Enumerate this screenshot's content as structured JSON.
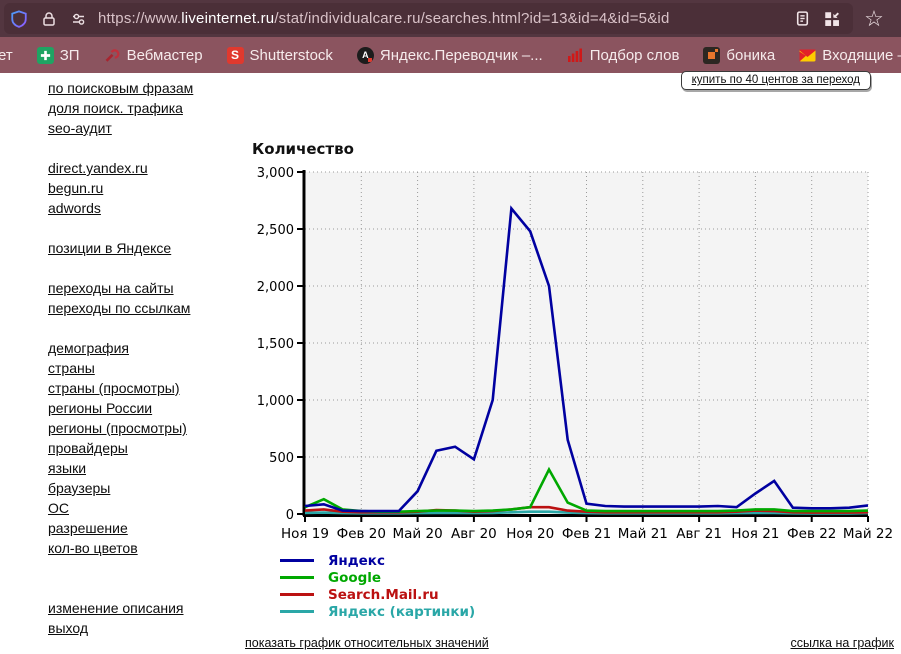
{
  "browser": {
    "url_prefix": "https://www.",
    "url_domain": "liveinternet.ru",
    "url_path": "/stat/individualcare.ru/searches.html?id=13&id=4&id=5&id"
  },
  "bookmarks": {
    "items": [
      {
        "label": "ет",
        "icon": "none"
      },
      {
        "label": "ЗП",
        "icon": "green-plus"
      },
      {
        "label": "Вебмастер",
        "icon": "red-wrench"
      },
      {
        "label": "Shutterstock",
        "icon": "shutterstock"
      },
      {
        "label": "Яндекс.Переводчик –...",
        "icon": "translator"
      },
      {
        "label": "Подбор слов",
        "icon": "red-bars"
      },
      {
        "label": "боника",
        "icon": "dark-orange-square"
      },
      {
        "label": "Входящие — Яндекс",
        "icon": "mail-envelope"
      }
    ]
  },
  "sidebar": {
    "groups": [
      [
        "по поисковым фразам",
        "доля поиск. трафика",
        "seo-аудит"
      ],
      [
        "direct.yandex.ru",
        "begun.ru",
        "adwords"
      ],
      [
        "позиции в Яндексе"
      ],
      [
        "переходы на сайты",
        "переходы по ссылкам"
      ],
      [
        "демография",
        "страны",
        "страны (просмотры)",
        "регионы России",
        "регионы (просмотры)",
        "провайдеры",
        "языки",
        "браузеры",
        "ОС",
        "разрешение",
        "кол-во цветов"
      ],
      [
        "изменение описания",
        "выход"
      ]
    ]
  },
  "page": {
    "buy_button_label": "купить по 40 центов за переход",
    "show_relative_label": "показать график относительных значений",
    "graph_link_label": "ссылка на график"
  },
  "chart_data": {
    "type": "line",
    "title": "Количество",
    "categories": [
      "Ноя 19",
      "Дек 19",
      "Янв 20",
      "Фев 20",
      "Мар 20",
      "Апр 20",
      "Май 20",
      "Июн 20",
      "Июл 20",
      "Авг 20",
      "Сен 20",
      "Окт 20",
      "Ноя 20",
      "Дек 20",
      "Янв 21",
      "Фев 21",
      "Мар 21",
      "Апр 21",
      "Май 21",
      "Июн 21",
      "Июл 21",
      "Авг 21",
      "Сен 21",
      "Окт 21",
      "Ноя 21",
      "Дек 21",
      "Янв 22",
      "Фев 22",
      "Мар 22",
      "Апр 22",
      "Май 22"
    ],
    "tick_labels": [
      "Ноя 19",
      "Фев 20",
      "Май 20",
      "Авг 20",
      "Ноя 20",
      "Фев 21",
      "Май 21",
      "Авг 21",
      "Ноя 21",
      "Фев 22",
      "Май 22"
    ],
    "ylim": [
      0,
      3000
    ],
    "ytick_step": 500,
    "ytick_labels": [
      "0",
      "500",
      "1,000",
      "1,500",
      "2,000",
      "2,500",
      "3,000"
    ],
    "grid": true,
    "legend_position": "bottom-left",
    "series": [
      {
        "name": "Яндекс",
        "color": "#0000a0",
        "values": [
          70,
          85,
          30,
          25,
          25,
          25,
          200,
          555,
          590,
          480,
          1000,
          2680,
          2480,
          2000,
          650,
          90,
          70,
          65,
          65,
          65,
          65,
          65,
          70,
          60,
          180,
          290,
          55,
          50,
          50,
          55,
          75
        ]
      },
      {
        "name": "Google",
        "color": "#00a800",
        "values": [
          60,
          130,
          40,
          25,
          20,
          20,
          25,
          30,
          30,
          25,
          30,
          40,
          60,
          390,
          100,
          30,
          25,
          25,
          25,
          25,
          25,
          25,
          25,
          30,
          40,
          40,
          25,
          25,
          25,
          25,
          30
        ]
      },
      {
        "name": "Search.Mail.ru",
        "color": "#bb1111",
        "values": [
          30,
          40,
          20,
          15,
          15,
          15,
          20,
          35,
          30,
          20,
          25,
          40,
          60,
          60,
          30,
          20,
          15,
          15,
          15,
          15,
          15,
          15,
          15,
          20,
          30,
          25,
          15,
          12,
          12,
          12,
          15
        ]
      },
      {
        "name": "Яндекс (картинки)",
        "color": "#2aa7a7",
        "values": [
          10,
          12,
          8,
          6,
          6,
          6,
          8,
          10,
          10,
          8,
          10,
          15,
          20,
          20,
          12,
          8,
          6,
          6,
          6,
          6,
          6,
          6,
          6,
          8,
          10,
          10,
          6,
          5,
          5,
          5,
          8
        ]
      }
    ]
  }
}
